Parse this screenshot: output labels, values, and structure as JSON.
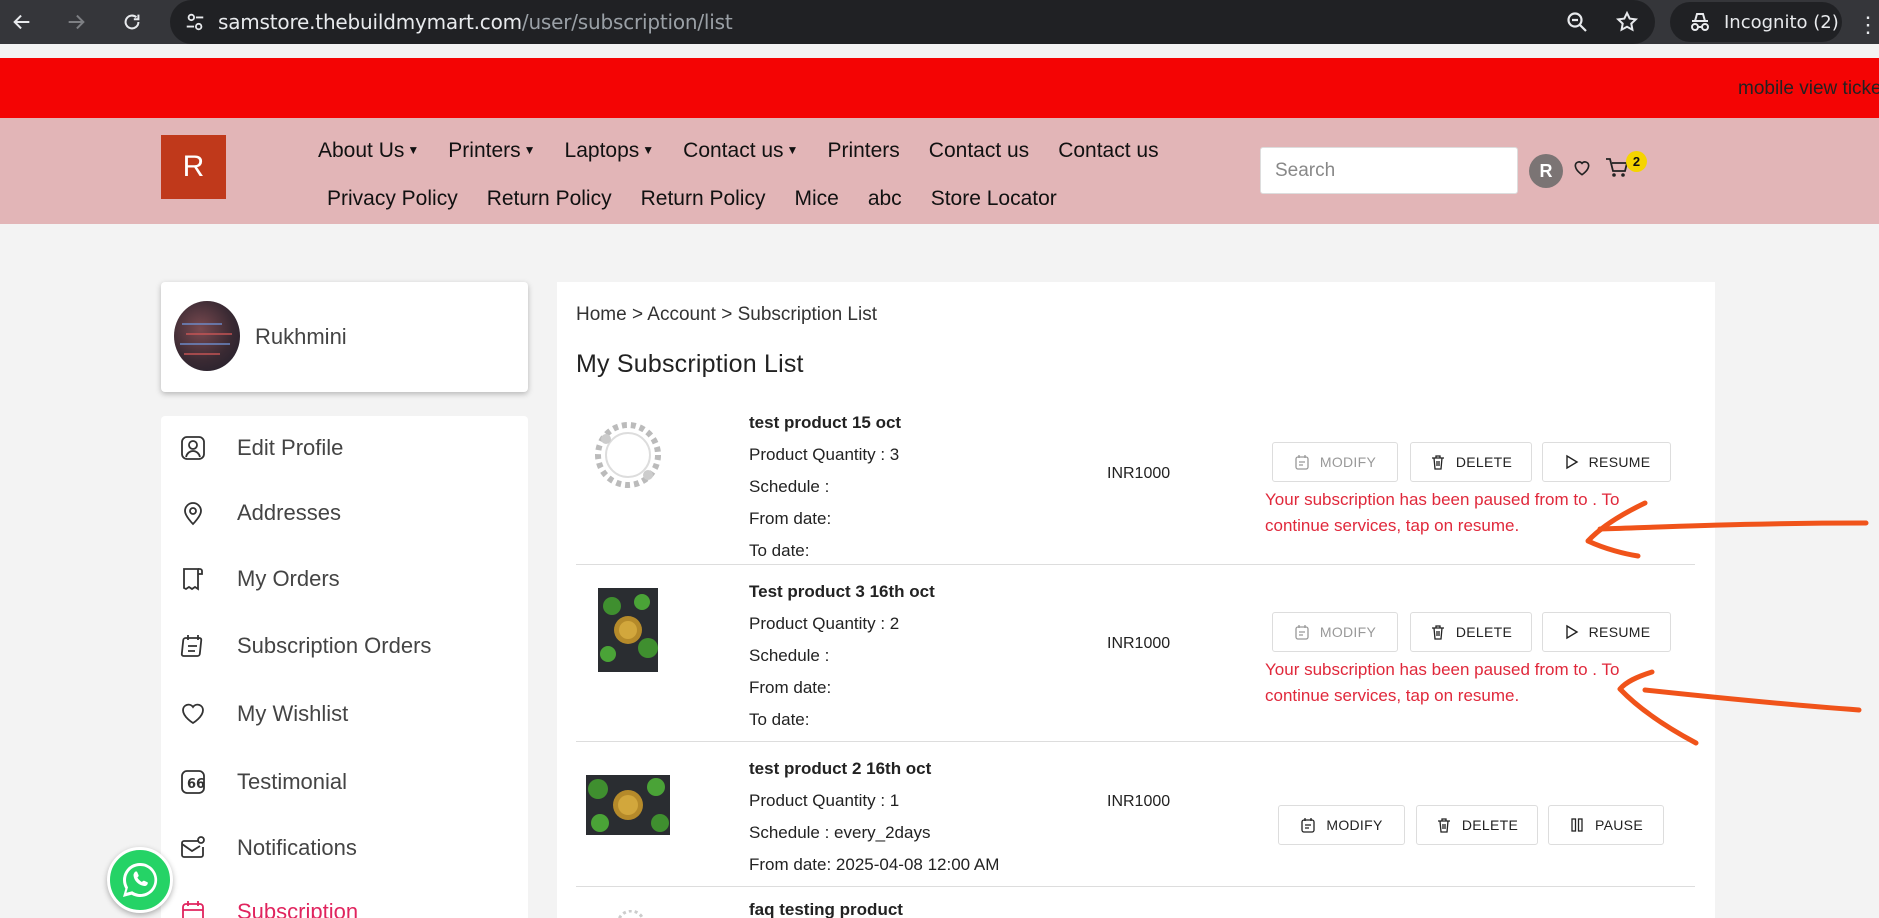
{
  "browser": {
    "url_host": "samstore.thebuildmymart.com",
    "url_path": "/user/subscription/list",
    "incognito_label": "Incognito (2)"
  },
  "ticker": {
    "text": "mobile view ticker"
  },
  "header": {
    "logo": "R",
    "menu_row1": [
      "About Us",
      "Printers",
      "Laptops",
      "Contact us",
      "Printers",
      "Contact us",
      "Contact us"
    ],
    "menu_row2": [
      "Privacy Policy",
      "Return Policy",
      "Return Policy",
      "Mice",
      "abc",
      "Store Locator"
    ],
    "search_placeholder": "Search",
    "avatar_initial": "R",
    "cart_count": "2"
  },
  "profile": {
    "name": "Rukhmini"
  },
  "sidebar": {
    "items": [
      {
        "label": "Edit Profile",
        "icon": "user-icon"
      },
      {
        "label": "Addresses",
        "icon": "location-pin-icon"
      },
      {
        "label": "My Orders",
        "icon": "receipt-icon"
      },
      {
        "label": "Subscription Orders",
        "icon": "calendar-list-icon"
      },
      {
        "label": "My Wishlist",
        "icon": "heart-icon"
      },
      {
        "label": "Testimonial",
        "icon": "quote-icon"
      },
      {
        "label": "Notifications",
        "icon": "mail-notification-icon"
      },
      {
        "label": "Subscription",
        "icon": "calendar-icon"
      }
    ]
  },
  "main": {
    "breadcrumb": "Home > Account > Subscription List",
    "title": "My Subscription List",
    "subscriptions": [
      {
        "name": "test product 15 oct",
        "quantity": "Product Quantity : 3",
        "schedule": "Schedule :",
        "from": "From date:",
        "to": "To date:",
        "price": "INR1000",
        "buttons": [
          "MODIFY",
          "DELETE",
          "RESUME"
        ],
        "message": "Your subscription has been paused from to . To continue services, tap on resume."
      },
      {
        "name": "Test product 3 16th oct",
        "quantity": "Product Quantity : 2",
        "schedule": "Schedule :",
        "from": "From date:",
        "to": "To date:",
        "price": "INR1000",
        "buttons": [
          "MODIFY",
          "DELETE",
          "RESUME"
        ],
        "message": "Your subscription has been paused from to . To continue services, tap on resume."
      },
      {
        "name": "test product 2 16th oct",
        "quantity": "Product Quantity : 1",
        "schedule": "Schedule : every_2days",
        "from": "From date: 2025-04-08 12:00 AM",
        "price": "INR1000",
        "buttons": [
          "MODIFY",
          "DELETE",
          "PAUSE"
        ]
      },
      {
        "name": "faq testing product"
      }
    ]
  },
  "colors": {
    "ticker": "#f40404",
    "header": "#e2b5b7",
    "logo": "#c0391b",
    "error": "#e0283b",
    "annotation": "#f0531a",
    "active": "#e0245e"
  }
}
